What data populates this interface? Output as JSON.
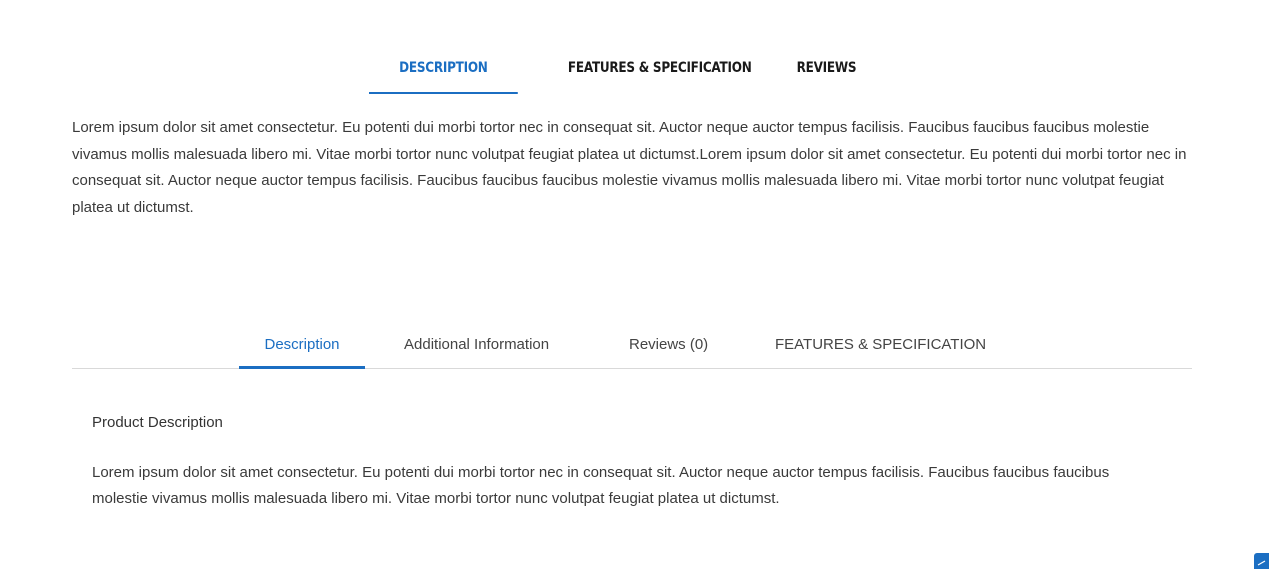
{
  "top_tabs": {
    "items": [
      {
        "label": "DESCRIPTION",
        "active": true
      },
      {
        "label": "FEATURES & SPECIFICATION",
        "active": false
      },
      {
        "label": "REVIEWS",
        "active": false
      }
    ],
    "paragraph": "Lorem ipsum dolor sit amet consectetur. Eu potenti dui morbi tortor nec in consequat sit. Auctor neque auctor tempus facilisis. Faucibus faucibus faucibus molestie vivamus mollis malesuada libero mi. Vitae morbi tortor nunc volutpat feugiat platea ut dictumst.Lorem ipsum dolor sit amet consectetur. Eu potenti dui morbi tortor nec in consequat sit. Auctor neque auctor tempus facilisis. Faucibus faucibus faucibus molestie vivamus mollis malesuada libero mi. Vitae morbi tortor nunc volutpat feugiat platea ut dictumst."
  },
  "bottom_tabs": {
    "items": [
      {
        "label": "Description",
        "active": true
      },
      {
        "label": "Additional Information",
        "active": false
      },
      {
        "label": "Reviews (0)",
        "active": false
      },
      {
        "label": "FEATURES & SPECIFICATION",
        "active": false
      }
    ],
    "heading": "Product Description",
    "paragraph": "Lorem ipsum dolor sit amet consectetur. Eu potenti dui morbi tortor nec in consequat sit. Auctor neque auctor tempus facilisis. Faucibus faucibus faucibus molestie vivamus mollis malesuada libero mi. Vitae morbi tortor nunc volutpat feugiat platea ut dictumst."
  },
  "corner_widget": {
    "icon": "resize-handle-icon"
  },
  "colors": {
    "accent": "#1b6ec2",
    "text": "#3a3a3a",
    "divider": "#d9d9d9"
  }
}
